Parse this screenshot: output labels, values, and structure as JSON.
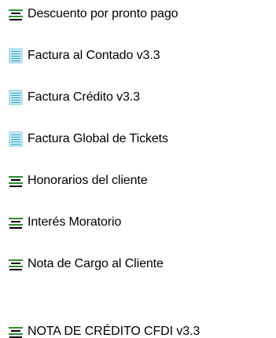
{
  "list": {
    "items": [
      {
        "label": "Descuento por pronto pago",
        "icon": "green-lines-icon"
      },
      {
        "label": "Factura al Contado v3.3",
        "icon": "document-lines-icon"
      },
      {
        "label": "Factura Crédito v3.3",
        "icon": "document-lines-icon"
      },
      {
        "label": "Factura Global de Tickets",
        "icon": "document-lines-icon"
      },
      {
        "label": "Honorarios del cliente",
        "icon": "green-lines-icon"
      },
      {
        "label": "Interés Moratorio",
        "icon": "green-lines-icon"
      },
      {
        "label": "Nota de Cargo al Cliente",
        "icon": "green-lines-icon"
      },
      {
        "label": "NOTA DE CRÉDITO CFDI v3.3",
        "icon": "green-lines-icon"
      }
    ]
  },
  "colors": {
    "green_line": "#2e8b2e",
    "black_line": "#000000",
    "doc_fill": "#c8ecf4",
    "doc_stripe": "#3aa0cc"
  }
}
